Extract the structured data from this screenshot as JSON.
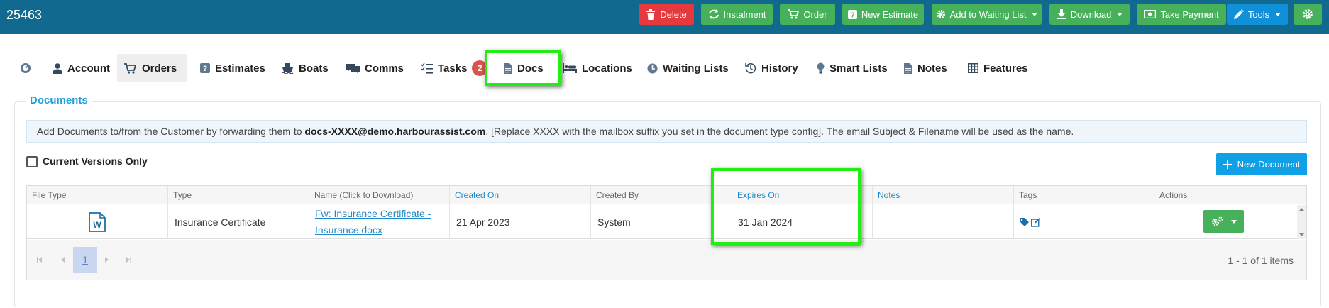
{
  "header": {
    "record_id": "25463",
    "buttons": {
      "delete": "Delete",
      "instalment": "Instalment",
      "order": "Order",
      "new_estimate": "New Estimate",
      "waiting_list": "Add to Waiting List",
      "download": "Download",
      "take_payment": "Take Payment",
      "tools": "Tools"
    }
  },
  "tabs": {
    "account": "Account",
    "orders": "Orders",
    "estimates": "Estimates",
    "boats": "Boats",
    "comms": "Comms",
    "tasks": "Tasks",
    "tasks_badge": "2",
    "docs": "Docs",
    "locations": "Locations",
    "waiting_lists": "Waiting Lists",
    "history": "History",
    "smart_lists": "Smart Lists",
    "notes": "Notes",
    "features": "Features"
  },
  "documents": {
    "title": "Documents",
    "info_prefix": "Add Documents to/from the Customer by forwarding them to",
    "info_email": "docs-XXXX@demo.harbourassist.com",
    "info_suffix": ". [Replace XXXX with the mailbox suffix you set in the document type config]. The email Subject & Filename will be used as the name.",
    "current_versions_label": "Current Versions Only",
    "new_document_label": "New Document"
  },
  "grid": {
    "columns": [
      "File Type",
      "Type",
      "Name (Click to Download)",
      "Created On",
      "Created By",
      "Expires On",
      "Notes",
      "Tags",
      "Actions"
    ],
    "rows": [
      {
        "file_icon": "word-doc-icon",
        "type": "Insurance Certificate",
        "name_line1": "Fw: Insurance Certificate -",
        "name_line2": "Insurance.docx",
        "created_on": "21 Apr 2023",
        "created_by": "System",
        "expires_on": "31 Jan 2024",
        "notes": ""
      }
    ],
    "pager": {
      "current_page": "1",
      "summary": "1 - 1 of 1 items"
    }
  },
  "colors": {
    "header_bg": "#11698f",
    "green_button": "#47b05b",
    "red_button": "#e5393d",
    "blue_button": "#0f90d8",
    "highlight": "#22ee11",
    "accent": "#1ea0d8"
  }
}
